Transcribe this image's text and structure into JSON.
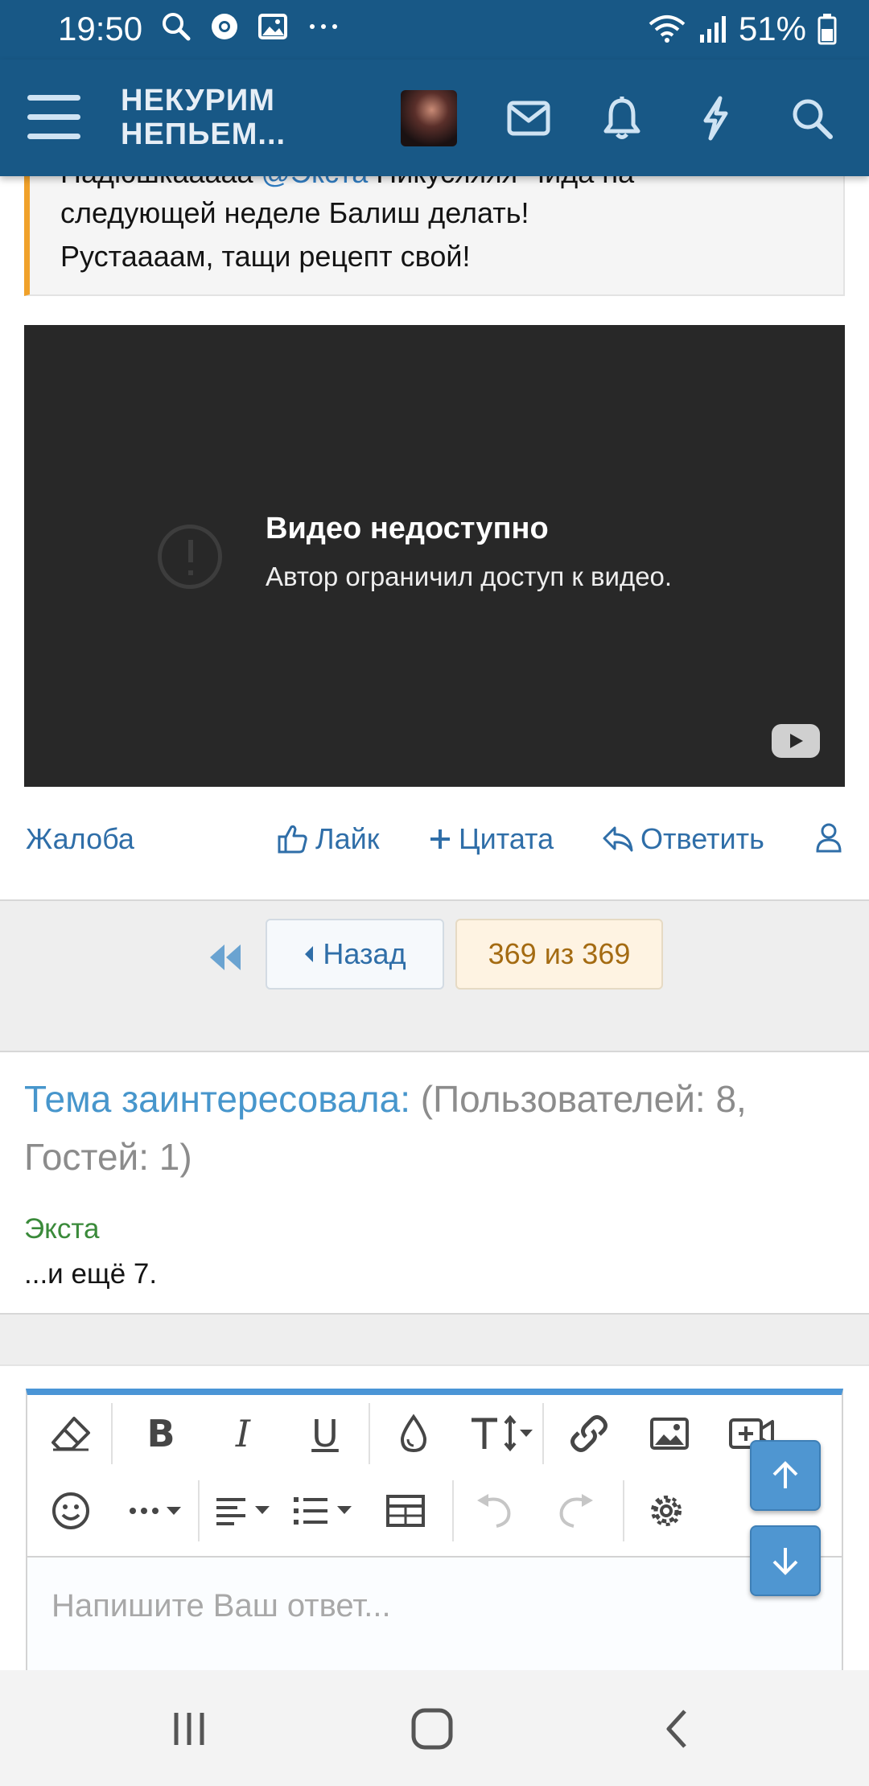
{
  "status_bar": {
    "time": "19:50",
    "battery_percent": "51%",
    "left_icons": [
      "search-icon",
      "chrome-icon",
      "image-icon",
      "more-dots-icon"
    ],
    "right_icons": [
      "wifi-icon",
      "signal-icon",
      "battery-icon"
    ]
  },
  "header": {
    "logo_line1": "НЕКУРИМ",
    "logo_line2": "НЕПЬЕМ...",
    "icons": [
      "menu-icon",
      "avatar",
      "mail-icon",
      "bell-icon",
      "lightning-icon",
      "search-icon"
    ]
  },
  "quote": {
    "line0_start": "Надюшкааааа",
    "mention": "@Экста",
    "line0_end": "Никусяяяя  Чида на",
    "line1": "следующей неделе Балиш делать!",
    "line2": "Рустаааам, тащи рецепт свой!"
  },
  "video": {
    "title": "Видео недоступно",
    "subtitle": "Автор ограничил доступ к видео."
  },
  "actions": {
    "report": "Жалоба",
    "like": "Лайк",
    "quote": "Цитата",
    "reply": "Ответить"
  },
  "pagination": {
    "prev": "Назад",
    "current": "369 из 369"
  },
  "interested": {
    "lead": "Тема заинтересовала:",
    "counts": "(Пользователей: 8, Гостей: 1)",
    "user": "Экста",
    "more": "...и ещё 7."
  },
  "editor": {
    "placeholder": "Напишите Ваш ответ...",
    "toolbar_row1": [
      "eraser-icon",
      "bold-icon",
      "italic-icon",
      "underline-icon",
      "color-drop-icon",
      "text-size-icon",
      "link-icon",
      "image-icon",
      "video-icon"
    ],
    "toolbar_row2": [
      "smiley-icon",
      "more-options-icon",
      "align-icon",
      "list-icon",
      "table-icon",
      "undo-icon",
      "redo-icon",
      "settings-icon"
    ]
  },
  "colors": {
    "header_bg": "#185886",
    "link": "#2f6ea8",
    "quote_border": "#f0a12a",
    "editor_accent": "#4a95d6",
    "current_page_text": "#a46b12"
  }
}
